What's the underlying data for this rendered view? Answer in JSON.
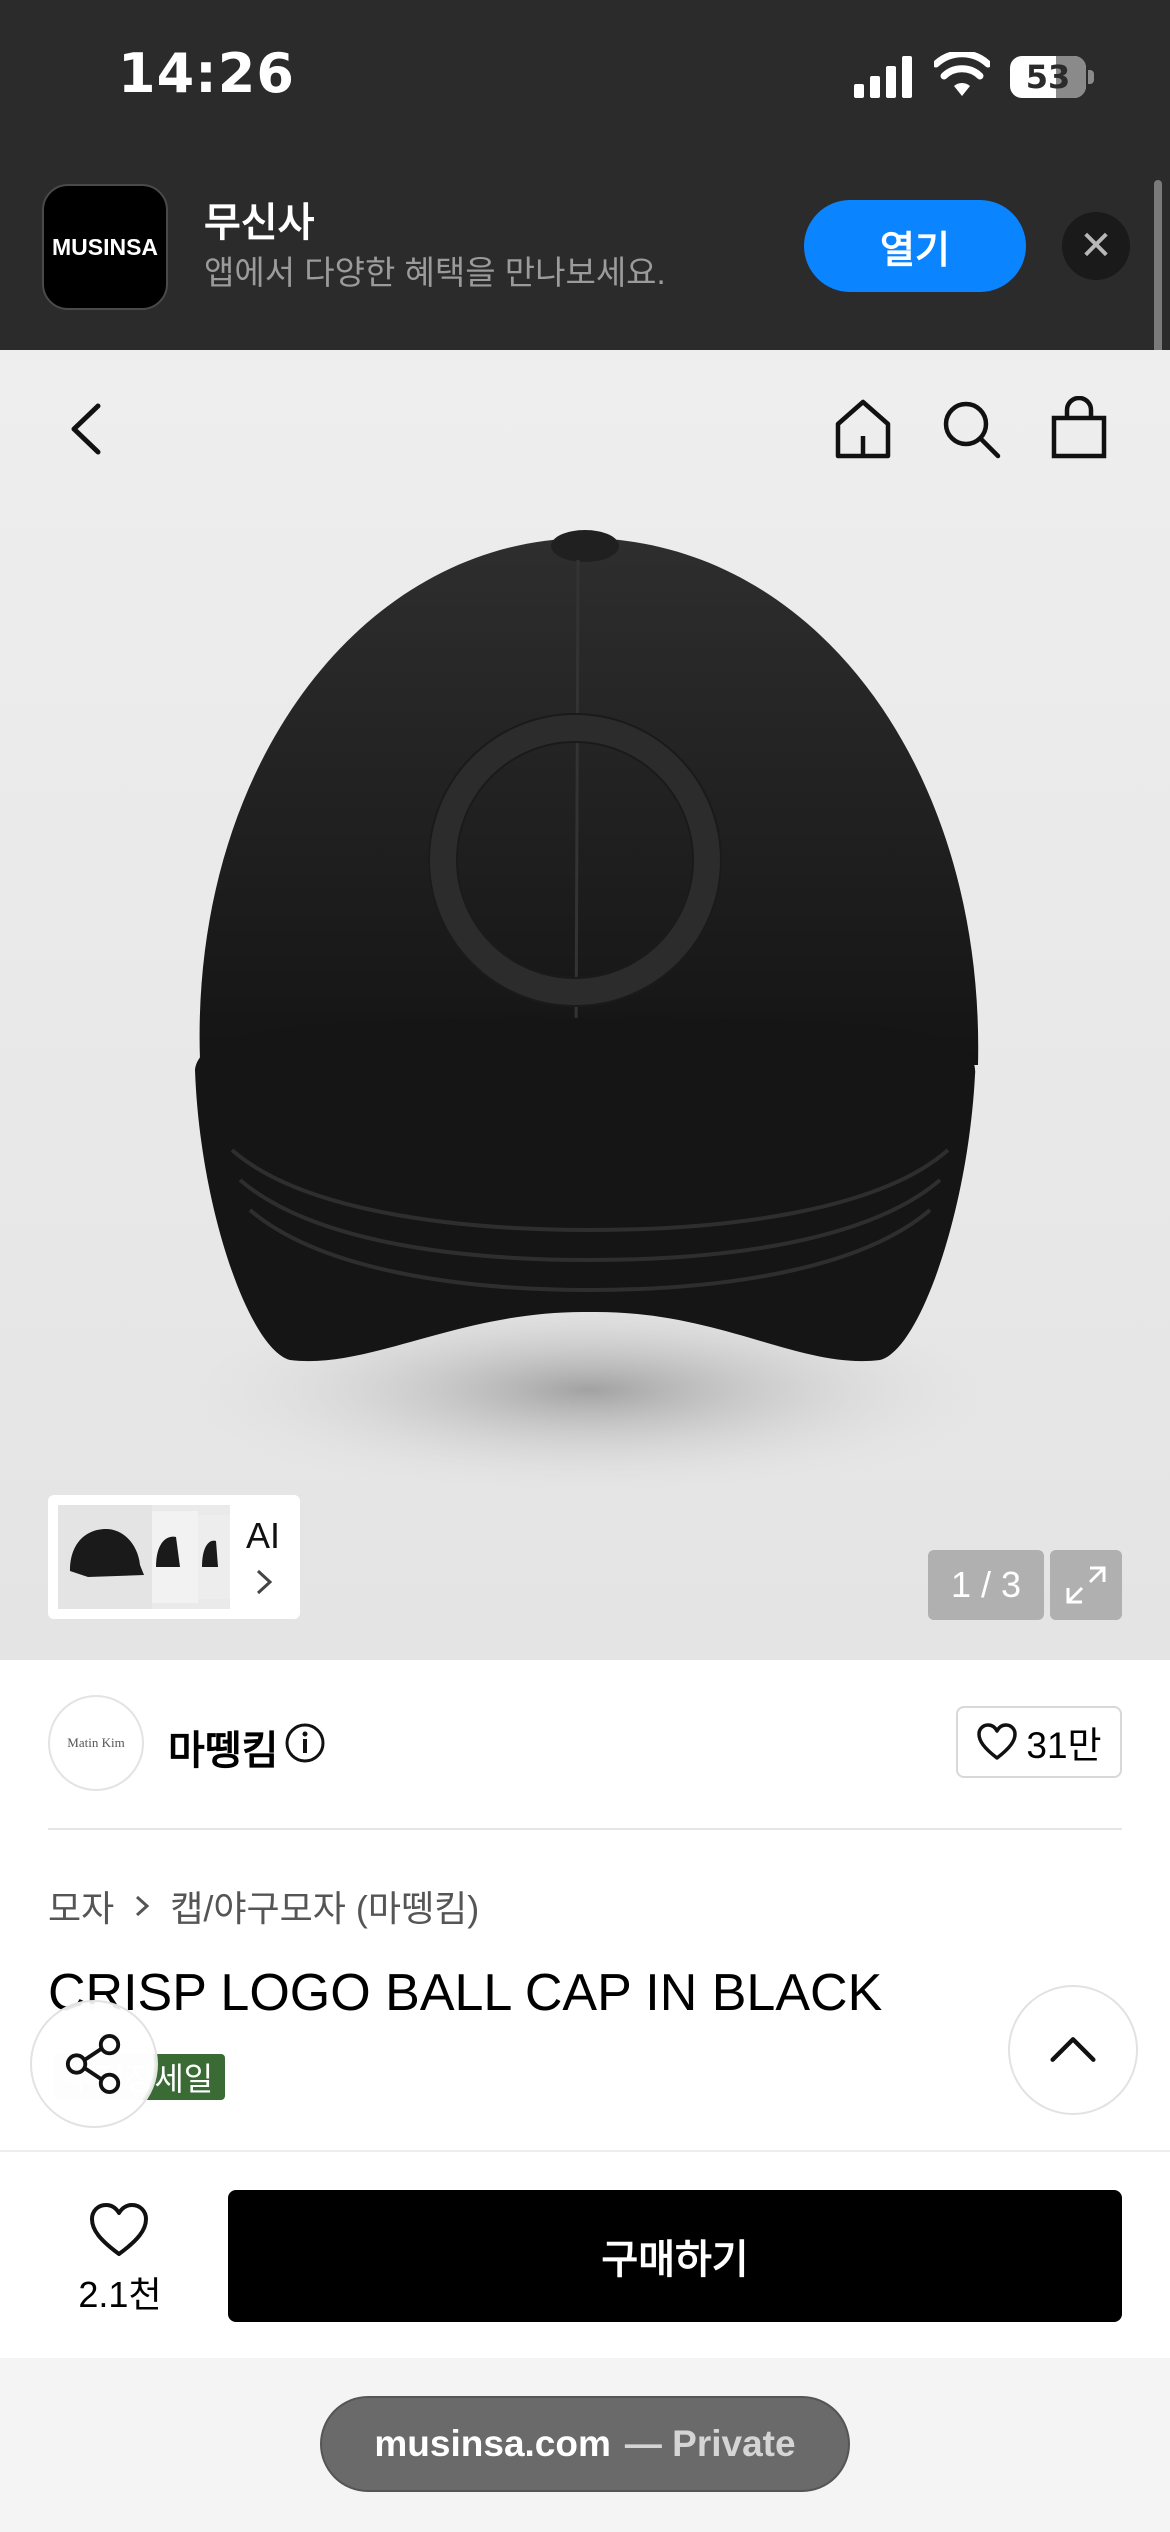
{
  "status_bar": {
    "time": "14:26",
    "battery": "53",
    "icons": [
      "signal-icon",
      "wifi-icon",
      "battery-icon"
    ]
  },
  "app_banner": {
    "logo_text": "MUSINSA",
    "app_name": "무신사",
    "description": "앱에서 다양한 혜택을 만나보세요.",
    "open_label": "열기",
    "close_icon": "close-icon",
    "accent_color": "#0a84ff"
  },
  "header_nav": {
    "icons": [
      "back-icon",
      "home-icon",
      "search-icon",
      "shopping-bag-icon"
    ]
  },
  "gallery": {
    "ai_label": "AI",
    "page_current": "1",
    "page_total": "3",
    "page_text": "1 / 3",
    "expand_icon": "expand-icon"
  },
  "brand": {
    "logo_text": "Matin  Kim",
    "name": "마뗑킴",
    "likes": "31만"
  },
  "product": {
    "breadcrumb": [
      "모자",
      "캡/야구모자 (마뗑킴)"
    ],
    "title": "CRISP LOGO BALL CAP IN BLACK",
    "badge": "무진장세일",
    "badge_color": "#3a6b35"
  },
  "floating": {
    "share_icon": "share-icon",
    "scroll_top_icon": "chevron-up-icon"
  },
  "bottom_bar": {
    "wish_count": "2.1천",
    "buy_label": "구매하기"
  },
  "browser": {
    "domain": "musinsa.com",
    "mode": "— Private"
  }
}
